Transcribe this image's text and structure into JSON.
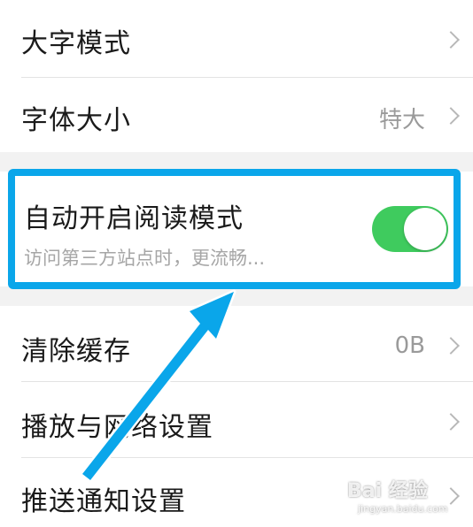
{
  "settings": {
    "large_font_mode": {
      "label": "大字模式"
    },
    "font_size": {
      "label": "字体大小",
      "value": "特大"
    },
    "auto_reading_mode": {
      "label": "自动开启阅读模式",
      "subtitle": "访问第三方站点时，更流畅...",
      "enabled": true
    },
    "clear_cache": {
      "label": "清除缓存",
      "value": "0B"
    },
    "playback_network": {
      "label": "播放与网络设置"
    },
    "push_notification": {
      "label": "推送通知设置"
    }
  },
  "colors": {
    "toggle_on": "#3fcb5e",
    "highlight_border": "#0aa6ea",
    "arrow": "#0aa6ea"
  },
  "icons": {
    "chevron": "chevron-right-icon"
  },
  "watermark": {
    "text": "Bai 经验",
    "sub": "jingyan.baidu.com"
  }
}
